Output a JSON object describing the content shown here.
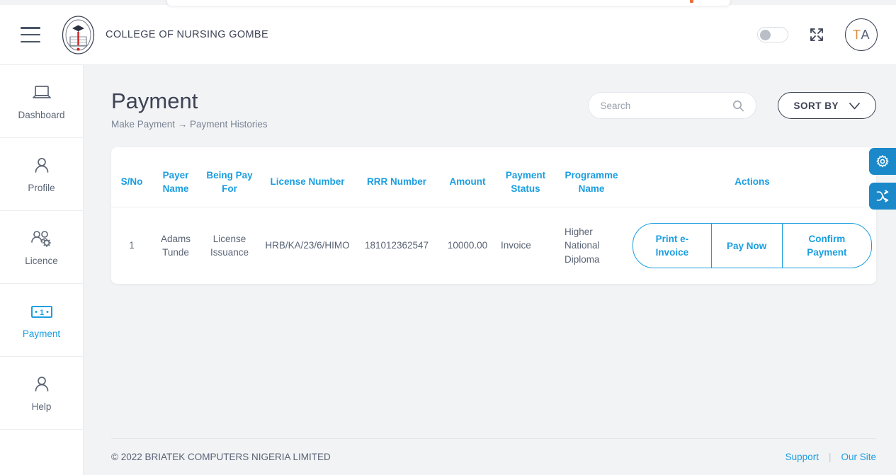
{
  "header": {
    "brand": "COLLEGE OF NURSING GOMBE",
    "avatar_initial_1": "T",
    "avatar_initial_2": "A",
    "menu_icon": "hamburger-menu-icon",
    "logo_icon": "college-crest-logo",
    "theme_toggle_state": "off",
    "fullscreen_icon": "expand-arrows-icon"
  },
  "sidebar": {
    "items": [
      {
        "label": "Dashboard",
        "icon": "laptop-icon",
        "active": false
      },
      {
        "label": "Profile",
        "icon": "user-icon",
        "active": false
      },
      {
        "label": "Licence",
        "icon": "users-gear-icon",
        "active": false
      },
      {
        "label": "Payment",
        "icon": "banknote-icon",
        "active": true
      },
      {
        "label": "Help",
        "icon": "user-icon",
        "active": false
      }
    ]
  },
  "page": {
    "title": "Payment",
    "breadcrumb": "Make Payment → Payment Histories"
  },
  "search": {
    "placeholder": "Search",
    "value": "",
    "icon": "search-icon"
  },
  "sort": {
    "label": "SORT BY",
    "icon": "chevron-down-icon"
  },
  "table": {
    "columns": [
      "S/No",
      "Payer Name",
      "Being Pay For",
      "License Number",
      "RRR Number",
      "Amount",
      "Payment Status",
      "Programme Name",
      "Actions"
    ],
    "rows": [
      {
        "sno": "1",
        "payer_name": "Adams Tunde",
        "being_pay_for": "License Issuance",
        "license_number": "HRB/KA/23/6/HIMO",
        "rrr_number": "181012362547",
        "amount": "10000.00",
        "payment_status": "Invoice",
        "programme_name": "Higher National Diploma",
        "actions": [
          "Print e-Invoice",
          "Pay Now",
          "Confirm Payment"
        ]
      }
    ]
  },
  "float_tabs": [
    {
      "icon": "gear-icon"
    },
    {
      "icon": "shuffle-icon"
    }
  ],
  "footer": {
    "copyright": "© 2022 BRIATEK COMPUTERS NIGERIA LIMITED",
    "support_label": "Support",
    "separator": "|",
    "site_label": "Our Site"
  },
  "colors": {
    "accent_blue": "#1a9ee0",
    "float_tab_blue": "#1a88c9",
    "dark_slate": "#3d4355",
    "body_text": "#5a6475",
    "page_bg": "#f2f3f5"
  }
}
